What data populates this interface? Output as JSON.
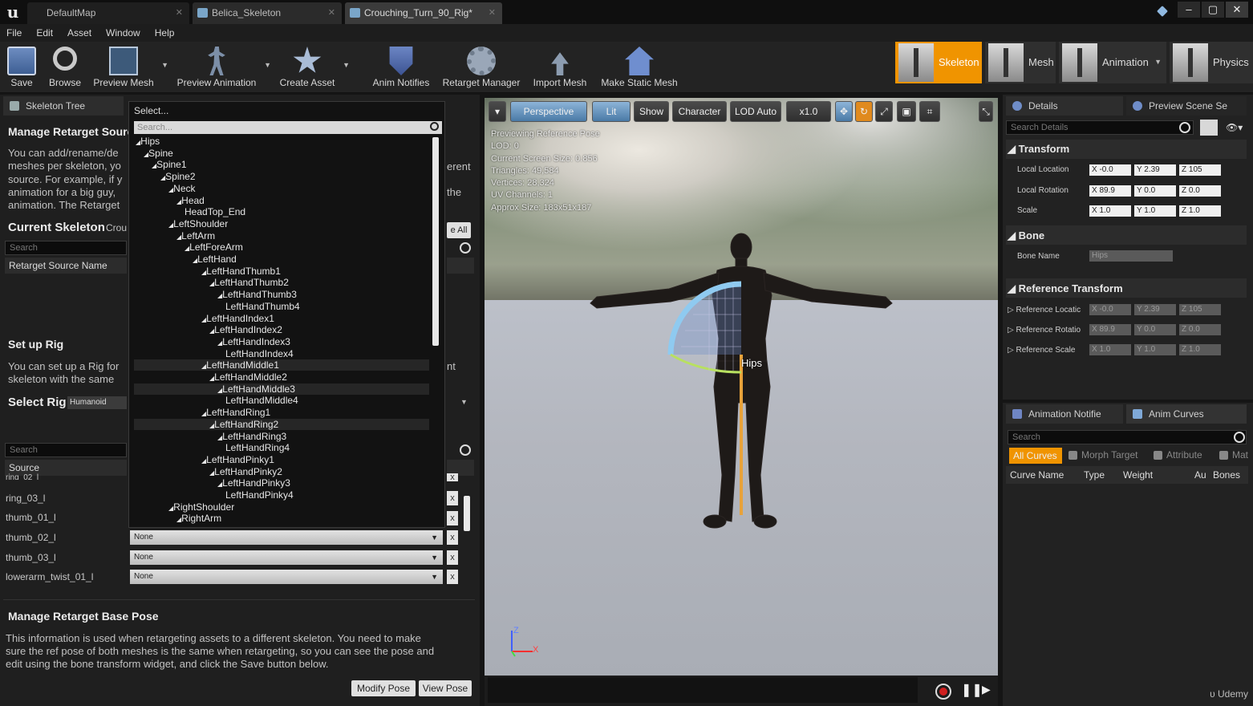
{
  "titlebar": {
    "tabs": [
      "DefaultMap",
      "Belica_Skeleton",
      "Crouching_Turn_90_Rig*"
    ],
    "buttons": [
      "–",
      "▢",
      "✕"
    ]
  },
  "menu": [
    "File",
    "Edit",
    "Asset",
    "Window",
    "Help"
  ],
  "toolbar": {
    "buttons": [
      {
        "label": "Save",
        "icon": "save-icon"
      },
      {
        "label": "Browse",
        "icon": "browse-icon"
      },
      {
        "label": "Preview Mesh",
        "icon": "preview-mesh-icon"
      },
      {
        "label": "Preview Animation",
        "icon": "preview-animation-icon"
      },
      {
        "label": "Create Asset",
        "icon": "create-asset-icon"
      },
      {
        "label": "Anim Notifies",
        "icon": "anim-notifies-icon"
      },
      {
        "label": "Retarget Manager",
        "icon": "retarget-manager-icon"
      },
      {
        "label": "Import Mesh",
        "icon": "import-mesh-icon"
      },
      {
        "label": "Make Static Mesh",
        "icon": "make-static-mesh-icon"
      }
    ],
    "modes": [
      "Skeleton",
      "Mesh",
      "Animation",
      "Physics"
    ],
    "active_mode": "Skeleton",
    "accent_color": "#f09400"
  },
  "left": {
    "tab_label": "Skeleton Tree",
    "manage_title": "Manage Retarget Sourc",
    "manage_text": [
      "You can add/rename/de",
      "meshes per skeleton, yo",
      "source. For example, if y",
      "animation for a big guy,",
      "animation. The Retarget"
    ],
    "manage_text_right": [
      "erent",
      "the"
    ],
    "current_skeleton_label": "Current Skeleton",
    "current_skeleton_value": "Crou",
    "save_all_partial": "e All",
    "search_placeholder": "Search",
    "source_name_header": "Retarget Source Name",
    "setup_title": "Set up Rig",
    "setup_text": [
      "You can set up a Rig for",
      "skeleton with the same"
    ],
    "setup_text_right": "nt",
    "select_rig_label": "Select Rig",
    "select_rig_value": "Humanoid",
    "search2_placeholder": "Search",
    "source_col": "Source",
    "rows": [
      {
        "label": "ring_02_l",
        "value": ""
      },
      {
        "label": "ring_03_l",
        "value": ""
      },
      {
        "label": "thumb_01_l",
        "value": ""
      },
      {
        "label": "thumb_02_l",
        "value": "None"
      },
      {
        "label": "thumb_03_l",
        "value": "None"
      },
      {
        "label": "lowerarm_twist_01_l",
        "value": "None"
      }
    ],
    "base_pose_title": "Manage Retarget Base Pose",
    "base_pose_text": [
      "This information is used when retargeting assets to a different skeleton. You need to make",
      "sure the ref pose of both meshes is the same when retargeting, so you can see the pose and",
      "edit using the bone transform widget, and click the Save button below."
    ],
    "modify_pose": "Modify Pose",
    "view_pose": "View Pose"
  },
  "popup": {
    "header": "Select...",
    "search_placeholder": "Search...",
    "bones": [
      {
        "name": "Hips",
        "depth": 0,
        "arrow": true
      },
      {
        "name": "Spine",
        "depth": 1,
        "arrow": true
      },
      {
        "name": "Spine1",
        "depth": 2,
        "arrow": true
      },
      {
        "name": "Spine2",
        "depth": 3,
        "arrow": true
      },
      {
        "name": "Neck",
        "depth": 4,
        "arrow": true
      },
      {
        "name": "Head",
        "depth": 5,
        "arrow": true
      },
      {
        "name": "HeadTop_End",
        "depth": 6,
        "arrow": false
      },
      {
        "name": "LeftShoulder",
        "depth": 4,
        "arrow": true
      },
      {
        "name": "LeftArm",
        "depth": 5,
        "arrow": true
      },
      {
        "name": "LeftForeArm",
        "depth": 6,
        "arrow": true
      },
      {
        "name": "LeftHand",
        "depth": 7,
        "arrow": true
      },
      {
        "name": "LeftHandThumb1",
        "depth": 8,
        "arrow": true
      },
      {
        "name": "LeftHandThumb2",
        "depth": 9,
        "arrow": true
      },
      {
        "name": "LeftHandThumb3",
        "depth": 10,
        "arrow": true
      },
      {
        "name": "LeftHandThumb4",
        "depth": 11,
        "arrow": false
      },
      {
        "name": "LeftHandIndex1",
        "depth": 8,
        "arrow": true
      },
      {
        "name": "LeftHandIndex2",
        "depth": 9,
        "arrow": true
      },
      {
        "name": "LeftHandIndex3",
        "depth": 10,
        "arrow": true
      },
      {
        "name": "LeftHandIndex4",
        "depth": 11,
        "arrow": false
      },
      {
        "name": "LeftHandMiddle1",
        "depth": 8,
        "arrow": true
      },
      {
        "name": "LeftHandMiddle2",
        "depth": 9,
        "arrow": true
      },
      {
        "name": "LeftHandMiddle3",
        "depth": 10,
        "arrow": true
      },
      {
        "name": "LeftHandMiddle4",
        "depth": 11,
        "arrow": false
      },
      {
        "name": "LeftHandRing1",
        "depth": 8,
        "arrow": true
      },
      {
        "name": "LeftHandRing2",
        "depth": 9,
        "arrow": true
      },
      {
        "name": "LeftHandRing3",
        "depth": 10,
        "arrow": true
      },
      {
        "name": "LeftHandRing4",
        "depth": 11,
        "arrow": false
      },
      {
        "name": "LeftHandPinky1",
        "depth": 8,
        "arrow": true
      },
      {
        "name": "LeftHandPinky2",
        "depth": 9,
        "arrow": true
      },
      {
        "name": "LeftHandPinky3",
        "depth": 10,
        "arrow": true
      },
      {
        "name": "LeftHandPinky4",
        "depth": 11,
        "arrow": false
      },
      {
        "name": "RightShoulder",
        "depth": 4,
        "arrow": true
      },
      {
        "name": "RightArm",
        "depth": 5,
        "arrow": true
      }
    ]
  },
  "viewport": {
    "buttons": [
      "Perspective",
      "Lit",
      "Show",
      "Character",
      "LOD Auto",
      "x1.0"
    ],
    "overlay": [
      "Previewing Reference Pose",
      "LOD: 0",
      "Current Screen Size: 0.856",
      "Triangles: 49,584",
      "Vertices: 28,324",
      "UV Channels: 1",
      "Approx Size: 183x51x187"
    ],
    "bone_label": "Hips",
    "axis_z": "Z",
    "axis_x": "X"
  },
  "right": {
    "details_tab": "Details",
    "preview_tab": "Preview Scene Se",
    "search_placeholder": "Search Details",
    "transform_title": "Transform",
    "transform_rows": [
      {
        "label": "Local Location",
        "x": "X -0.0",
        "y": "Y 2.39",
        "z": "Z 105"
      },
      {
        "label": "Local Rotation",
        "x": "X 89.9",
        "y": "Y 0.0",
        "z": "Z 0.0"
      },
      {
        "label": "Scale",
        "x": "X 1.0",
        "y": "Y 1.0",
        "z": "Z 1.0"
      }
    ],
    "bone_title": "Bone",
    "bone_name_label": "Bone Name",
    "bone_name_value": "Hips",
    "ref_title": "Reference Transform",
    "ref_rows": [
      {
        "label": "Reference Locatic",
        "x": "X -0.0",
        "y": "Y 2.39",
        "z": "Z 105"
      },
      {
        "label": "Reference Rotatio",
        "x": "X 89.9",
        "y": "Y 0.0",
        "z": "Z 0.0"
      },
      {
        "label": "Reference Scale",
        "x": "X 1.0",
        "y": "Y 1.0",
        "z": "Z 1.0"
      }
    ],
    "anim_notifies_tab": "Animation Notifie",
    "anim_curves_tab": "Anim Curves",
    "curves_search": "Search",
    "all_curves": "All Curves",
    "filters": [
      "Morph Target",
      "Attribute",
      "Mat"
    ],
    "columns": [
      "Curve Name",
      "Type",
      "Weight",
      "Au",
      "Bones"
    ]
  },
  "watermark": "Udemy"
}
